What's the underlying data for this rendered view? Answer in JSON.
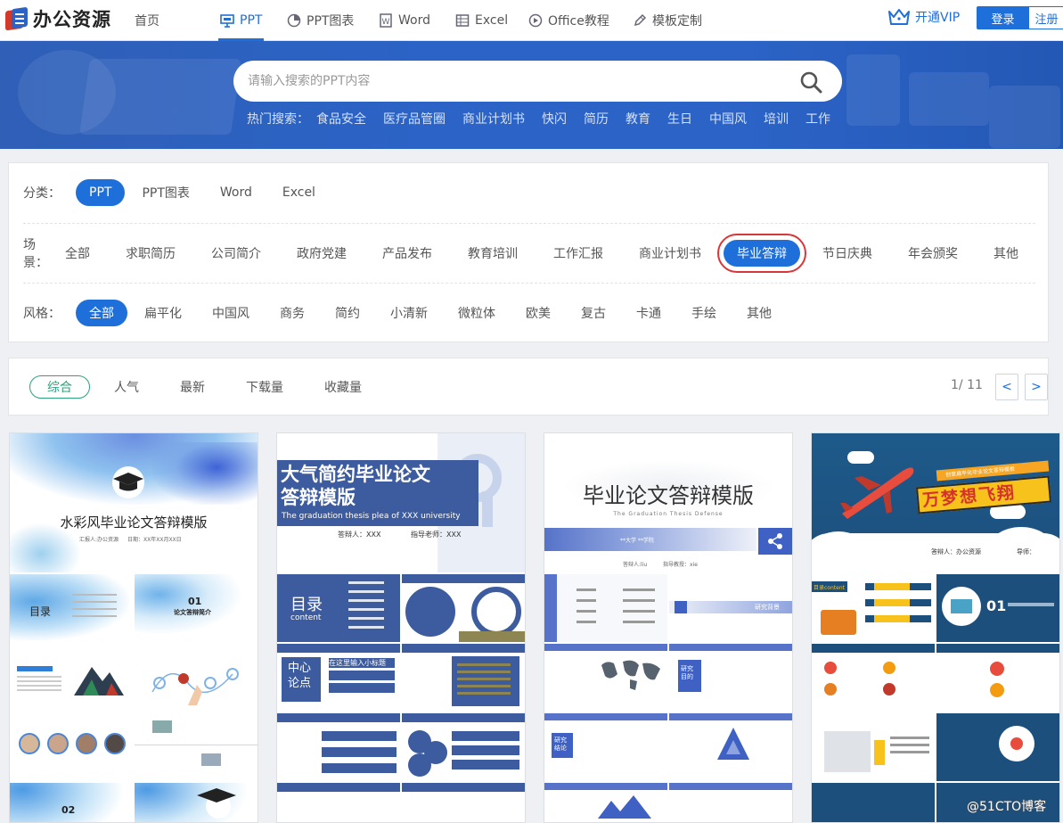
{
  "brand": {
    "name": "办公资源"
  },
  "nav": {
    "items": [
      {
        "label": "首页",
        "icon": "none"
      },
      {
        "label": "PPT",
        "icon": "presentation-icon"
      },
      {
        "label": "PPT图表",
        "icon": "pie-chart-icon"
      },
      {
        "label": "Word",
        "icon": "word-doc-icon"
      },
      {
        "label": "Excel",
        "icon": "table-grid-icon"
      },
      {
        "label": "Office教程",
        "icon": "play-circle-icon"
      },
      {
        "label": "模板定制",
        "icon": "pen-icon"
      }
    ],
    "active": "PPT",
    "vip_label": "开通VIP",
    "login_label": "登录",
    "register_label": "注册"
  },
  "hero": {
    "search_placeholder": "请输入搜索的PPT内容",
    "hot_label": "热门搜索：",
    "hot_keywords": [
      "食品安全",
      "医疗品管圈",
      "商业计划书",
      "快闪",
      "简历",
      "教育",
      "生日",
      "中国风",
      "培训",
      "工作"
    ]
  },
  "filters": {
    "category": {
      "label": "分类：",
      "options": [
        "PPT",
        "PPT图表",
        "Word",
        "Excel"
      ],
      "selected": "PPT"
    },
    "scene": {
      "label": "场景：",
      "options": [
        "全部",
        "求职简历",
        "公司简介",
        "政府党建",
        "产品发布",
        "教育培训",
        "工作汇报",
        "商业计划书",
        "毕业答辩",
        "节日庆典",
        "年会颁奖",
        "其他"
      ],
      "selected": "毕业答辩"
    },
    "style": {
      "label": "风格：",
      "options": [
        "全部",
        "扁平化",
        "中国风",
        "商务",
        "简约",
        "小清新",
        "微粒体",
        "欧美",
        "复古",
        "卡通",
        "手绘",
        "其他"
      ],
      "selected": "全部"
    }
  },
  "sort": {
    "options": [
      "综合",
      "人气",
      "最新",
      "下载量",
      "收藏量"
    ],
    "selected": "综合",
    "page_indicator": "1/ 11",
    "prev": "<",
    "next": ">"
  },
  "cards": [
    {
      "title": "水彩风毕业论文答辩模版",
      "reporter": "汇报人:办公资源",
      "date": "日期：XX年XX月XX日",
      "thumb_texts": [
        "目录",
        "01",
        "论文答辩简介",
        "02"
      ]
    },
    {
      "title_line1": "大气简约毕业论文",
      "title_line2": "答辩模版",
      "subtitle": "The graduation thesis plea of XXX university",
      "defender": "答辩人：XXX",
      "advisor": "指导老师：XXX",
      "thumb_texts": [
        "目录",
        "content",
        "中心",
        "论点",
        "在这里输入小标题"
      ]
    },
    {
      "title": "毕业论文答辩模版",
      "subtitle": "The Graduation Thesis Defense",
      "band_text": "**大学 **学院",
      "defender": "答辩人:liu",
      "advisor": "指导教授：xie",
      "thumb_texts": [
        "研究背景",
        "研究目的",
        "研究结论"
      ]
    },
    {
      "banner_top": "创意扁平化毕业论文答辩模板",
      "banner_main": "万梦想飞翔",
      "footer_left": "答辩人：办公资源",
      "footer_right": "导师：",
      "thumb_texts": [
        "目录content",
        "01"
      ]
    }
  ],
  "watermark": "@51CTO博客"
}
